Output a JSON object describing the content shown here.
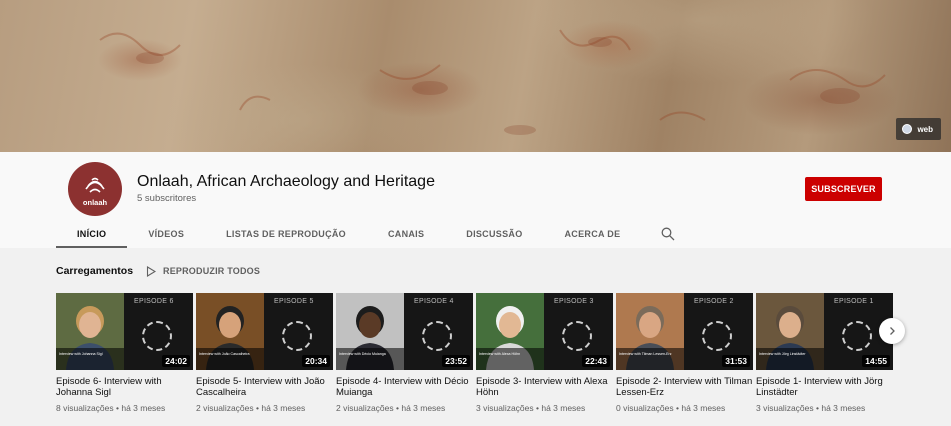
{
  "banner": {
    "web_link_label": "web",
    "web_icon": "globe-icon"
  },
  "channel": {
    "name": "Onlaah, African Archaeology and Heritage",
    "subscribers": "5 subscritores",
    "avatar_text": "onlaah",
    "subscribe_label": "SUBSCREVER"
  },
  "tabs": [
    {
      "label": "INÍCIO",
      "active": true
    },
    {
      "label": "VÍDEOS",
      "active": false
    },
    {
      "label": "LISTAS DE REPRODUÇÃO",
      "active": false
    },
    {
      "label": "CANAIS",
      "active": false
    },
    {
      "label": "DISCUSSÃO",
      "active": false
    },
    {
      "label": "ACERCA DE",
      "active": false
    }
  ],
  "section": {
    "title": "Carregamentos",
    "play_all_label": "REPRODUZIR TODOS"
  },
  "videos": [
    {
      "episode_label": "EPISODE 6",
      "duration": "24:02",
      "title": "Episode 6- Interview with Johanna Sigl",
      "views": "8 visualizações",
      "age": "há 3 meses",
      "thumb_caption": "Interview with Johanna Sigl",
      "photo_bg": "#6b7a4c",
      "face": "#e0b493",
      "hair": "#c79a5b",
      "shirt": "#3c4f6b"
    },
    {
      "episode_label": "EPISODE 5",
      "duration": "20:34",
      "title": "Episode 5- Interview with João Cascalheira",
      "views": "2 visualizações",
      "age": "há 3 meses",
      "thumb_caption": "Interview with João Cascalheira",
      "photo_bg": "#8a5a2c",
      "face": "#d6a27a",
      "hair": "#222222",
      "shirt": "#2a2a2a"
    },
    {
      "episode_label": "EPISODE 4",
      "duration": "23:52",
      "title": "Episode 4- Interview with Décio Muianga",
      "views": "2 visualizações",
      "age": "há 3 meses",
      "thumb_caption": "Interview with Décio Muianga",
      "photo_bg": "#dcdcdc",
      "face": "#5a3a26",
      "hair": "#1c1c1c",
      "shirt": "#2b2b33"
    },
    {
      "episode_label": "EPISODE 3",
      "duration": "22:43",
      "title": "Episode 3- Interview with Alexa Höhn",
      "views": "3 visualizações",
      "age": "há 3 meses",
      "thumb_caption": "Interview with Alexa Höhn",
      "photo_bg": "#4f7f45",
      "face": "#e2b894",
      "hair": "#f0f0f0",
      "shirt": "#d9d9d9"
    },
    {
      "episode_label": "EPISODE 2",
      "duration": "31:53",
      "title": "Episode 2- Interview with Tilman Lessen-Erz",
      "views": "0 visualizações",
      "age": "há 3 meses",
      "thumb_caption": "Interview with Tilman Lessen-Erz",
      "photo_bg": "#c88a5a",
      "face": "#d9a683",
      "hair": "#7b6b5a",
      "shirt": "#4a4e57"
    },
    {
      "episode_label": "EPISODE 1",
      "duration": "14:55",
      "title": "Episode 1- Interview with Jörg Linstädter",
      "views": "3 visualizações",
      "age": "há 3 meses",
      "thumb_caption": "Interview with Jörg Linstädter",
      "photo_bg": "#7a6446",
      "face": "#dcaf8c",
      "hair": "#5a4b3c",
      "shirt": "#2c3a52"
    }
  ],
  "colors": {
    "subscribe": "#cc0000",
    "avatar": "#8c3130"
  }
}
